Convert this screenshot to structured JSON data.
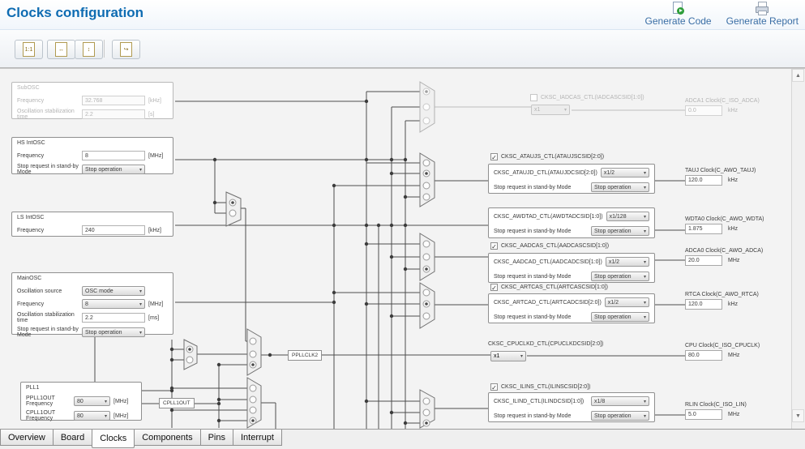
{
  "header": {
    "title": "Clocks configuration",
    "actions": {
      "generate_code": "Generate Code",
      "generate_report": "Generate Report"
    }
  },
  "toolbar": {
    "buttons": [
      {
        "name": "zoom-one-to-one",
        "glyph": "1:1"
      },
      {
        "name": "fit-horizontal",
        "glyph": "↔"
      },
      {
        "name": "fit-vertical",
        "glyph": "↕"
      },
      {
        "name": "export-image",
        "glyph": "↪"
      }
    ]
  },
  "icons": {
    "select_arrow": "▾",
    "check": "✓",
    "scroll_up": "▲",
    "scroll_down": "▼"
  },
  "oscillators": {
    "subosc": {
      "title": "SubOSC",
      "frequency_label": "Frequency",
      "frequency_value": "32.768",
      "frequency_unit": "[kHz]",
      "stab_label": "Oscillation stabilization time",
      "stab_value": "2.2",
      "stab_unit": "[s]"
    },
    "hs_intosc": {
      "title": "HS IntOSC",
      "frequency_label": "Frequency",
      "frequency_value": "8",
      "frequency_unit": "[MHz]",
      "standby_label": "Stop request in stand-by Mode",
      "standby_value": "Stop operation"
    },
    "ls_intosc": {
      "title": "LS IntOSC",
      "frequency_label": "Frequency",
      "frequency_value": "240",
      "frequency_unit": "[kHz]"
    },
    "mainosc": {
      "title": "MainOSC",
      "source_label": "Oscillation source",
      "source_value": "OSC mode",
      "frequency_label": "Frequency",
      "frequency_value": "8",
      "frequency_unit": "[MHz]",
      "stab_label": "Oscillation stabilization time",
      "stab_value": "2.2",
      "stab_unit": "[ms]",
      "standby_label": "Stop request in stand-by Mode",
      "standby_value": "Stop operation"
    },
    "pll1": {
      "title": "PLL1",
      "ppll_label": "PPLL1OUT Frequency",
      "ppll_value": "80",
      "ppll_unit": "[MHz]",
      "cpll_label": "CPLL1OUT Frequency",
      "cpll_value": "80",
      "cpll_unit": "[MHz]"
    }
  },
  "nodes": {
    "cpll1out": "CPLL1OUT",
    "ppllclk2": "PPLLCLK2"
  },
  "selectors": {
    "iadcas": {
      "label": "CKSC_IADCAS_CTL(IADCASCSID[1:0])",
      "value": "x1",
      "checked": false
    },
    "ataujs": {
      "label": "CKSC_ATAUJS_CTL(ATAUJSCSID[2:0])",
      "checked": true,
      "divider_label": "CKSC_ATAUJD_CTL(ATAUJDCSID[2:0])",
      "divider_value": "x1/2",
      "standby_label": "Stop request in stand-by Mode",
      "standby_value": "Stop operation"
    },
    "awdtad": {
      "divider_label": "CKSC_AWDTAD_CTL(AWDTADCSID[1:0])",
      "divider_value": "x1/128",
      "standby_label": "Stop request in stand-by Mode",
      "standby_value": "Stop operation"
    },
    "aadcas": {
      "label": "CKSC_AADCAS_CTL(AADCASCSID[1:0])",
      "checked": true,
      "divider_label": "CKSC_AADCAD_CTL(AADCADCSID[1:0])",
      "divider_value": "x1/2",
      "standby_label": "Stop request in stand-by Mode",
      "standby_value": "Stop operation"
    },
    "artcas": {
      "label": "CKSC_ARTCAS_CTL(ARTCASCSID[1:0])",
      "checked": true,
      "divider_label": "CKSC_ARTCAD_CTL(ARTCADCSID[2:0])",
      "divider_value": "x1/2",
      "standby_label": "Stop request in stand-by Mode",
      "standby_value": "Stop operation"
    },
    "cpuclkd": {
      "label": "CKSC_CPUCLKD_CTL(CPUCLKDCSID[2:0])",
      "value": "x1"
    },
    "ilins": {
      "label": "CKSC_ILINS_CTL(ILINSCSID[2:0])",
      "checked": true,
      "divider_label": "CKSC_ILIND_CTL(ILINDCSID[1:0])",
      "divider_value": "x1/8",
      "standby_label": "Stop request in stand-by Mode",
      "standby_value": "Stop operation"
    }
  },
  "outputs": {
    "adca1": {
      "label": "ADCA1 Clock(C_ISO_ADCA)",
      "value": "0.0",
      "unit": "kHz"
    },
    "tauj": {
      "label": "TAUJ Clock(C_AWO_TAUJ)",
      "value": "120.0",
      "unit": "kHz"
    },
    "wdta0": {
      "label": "WDTA0 Clock(C_AWO_WDTA)",
      "value": "1.875",
      "unit": "kHz"
    },
    "adca0": {
      "label": "ADCA0 Clock(C_AWO_ADCA)",
      "value": "20.0",
      "unit": "MHz"
    },
    "rtca": {
      "label": "RTCA Clock(C_AWO_RTCA)",
      "value": "120.0",
      "unit": "kHz"
    },
    "cpu": {
      "label": "CPU Clock(C_ISO_CPUCLK)",
      "value": "80.0",
      "unit": "MHz"
    },
    "rlin": {
      "label": "RLIN Clock(C_ISO_LIN)",
      "value": "5.0",
      "unit": "MHz"
    }
  },
  "tabs": {
    "items": [
      "Overview",
      "Board",
      "Clocks",
      "Components",
      "Pins",
      "Interrupt"
    ],
    "active": "Clocks"
  }
}
